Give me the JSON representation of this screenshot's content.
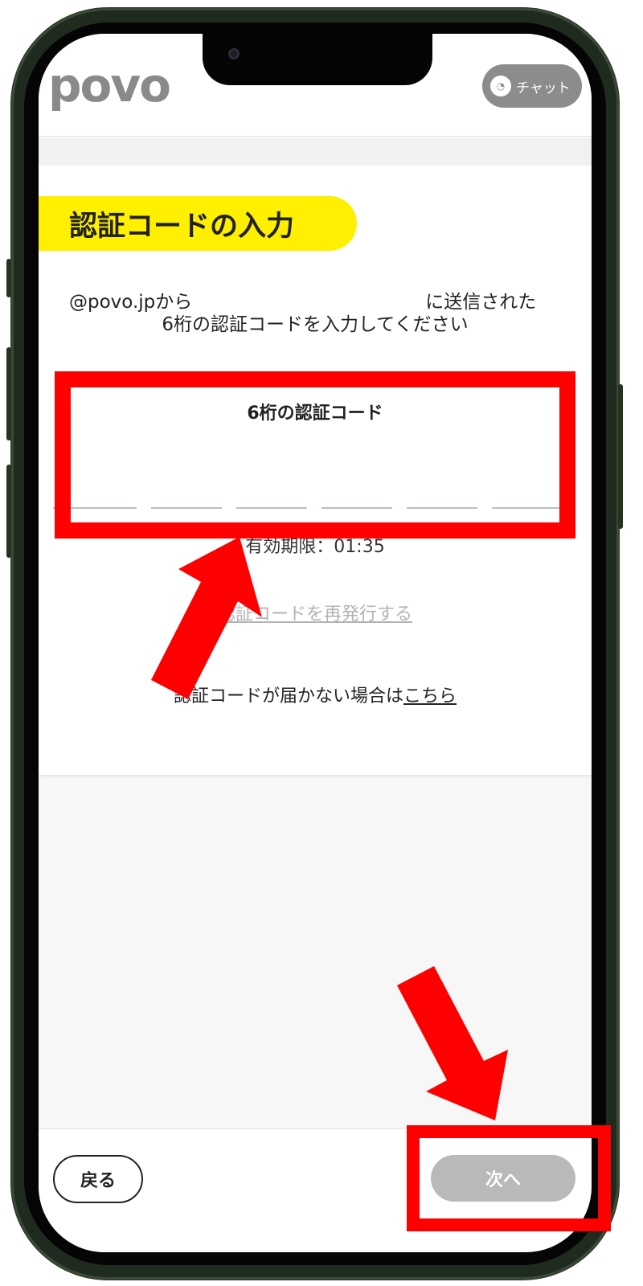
{
  "app": {
    "logo_text": "povo",
    "chat_label": "チャット",
    "chat_icon": "chat-icon"
  },
  "verification": {
    "title": "認証コードの入力",
    "instruction_from": "@povo.jpから",
    "instruction_sent": "に送信された",
    "instruction_line2": "6桁の認証コードを入力してください",
    "code_label": "6桁の認証コード",
    "code_length": 6,
    "expiry_label": "有効期限：",
    "expiry_value": "01:35",
    "reissue_link": "認証コードを再発行する",
    "not_received_text": "認証コードが届かない場合は",
    "not_received_link": "こちら"
  },
  "footer": {
    "back_label": "戻る",
    "next_label": "次へ"
  },
  "colors": {
    "brand_yellow": "#ffef00",
    "highlight_red": "#ff0000",
    "disabled_gray": "#b9b9b9"
  }
}
